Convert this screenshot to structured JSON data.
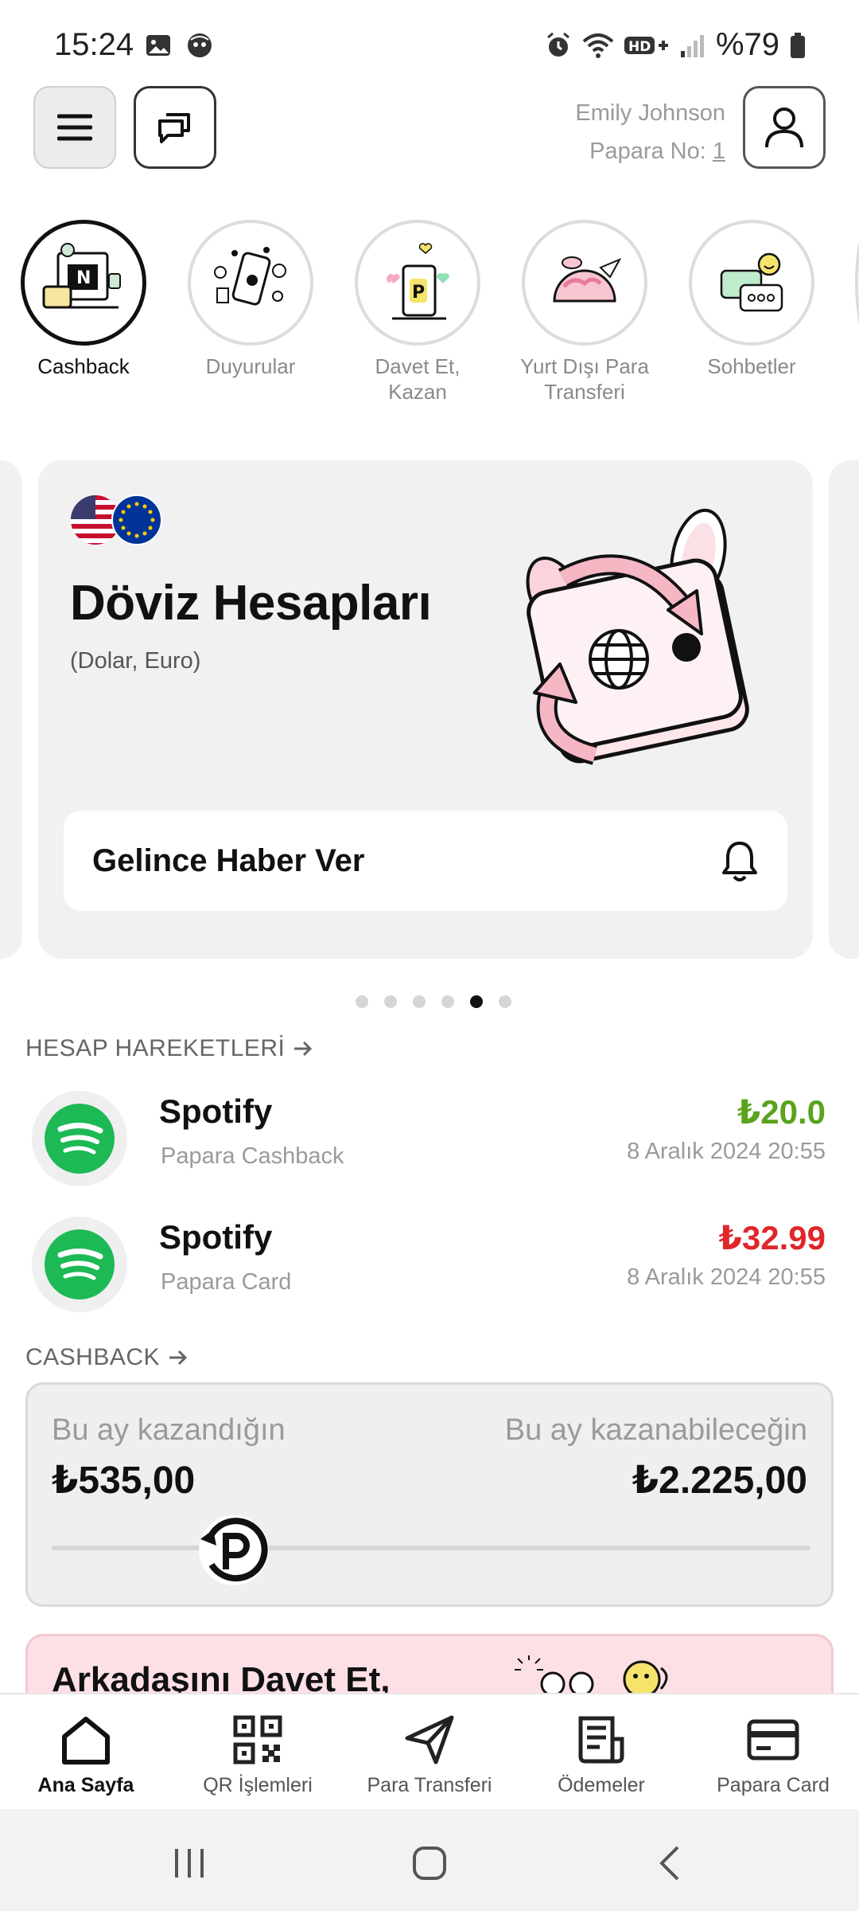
{
  "status_bar": {
    "time": "15:24",
    "battery": "%79",
    "icons": [
      "image-icon",
      "face-icon",
      "alarm-icon",
      "wifi-icon",
      "hd-plus-icon",
      "signal-icon",
      "battery-icon"
    ]
  },
  "header": {
    "user_name": "Emily Johnson",
    "papara_no_label": "Papara No:",
    "papara_no_value": "1"
  },
  "stories": [
    {
      "label": "Cashback",
      "active": true
    },
    {
      "label": "Duyurular",
      "active": false
    },
    {
      "label": "Davet Et, Kazan",
      "active": false
    },
    {
      "label": "Yurt Dışı Para Transferi",
      "active": false
    },
    {
      "label": "Sohbetler",
      "active": false
    }
  ],
  "promo": {
    "title": "Döviz Hesapları",
    "subtitle": "(Dolar, Euro)",
    "button_label": "Gelince Haber Ver",
    "dots_count": 6,
    "active_dot": 5
  },
  "transactions": {
    "heading": "HESAP HAREKETLERİ",
    "items": [
      {
        "name": "Spotify",
        "sub": "Papara Cashback",
        "amount": "₺20.0",
        "date": "8 Aralık 2024 20:55",
        "color": "#5aa31c"
      },
      {
        "name": "Spotify",
        "sub": "Papara Card",
        "amount": "₺32.99",
        "date": "8 Aralık 2024 20:55",
        "color": "#e0262b"
      }
    ]
  },
  "cashback": {
    "heading": "CASHBACK",
    "earned_label": "Bu ay kazandığın",
    "earned_value": "₺535,00",
    "potential_label": "Bu ay kazanabileceğin",
    "potential_value": "₺2.225,00",
    "progress_fraction": 0.24
  },
  "invite": {
    "title": "Arkadaşını Davet Et,"
  },
  "bottom_nav": [
    {
      "label": "Ana Sayfa",
      "icon": "home-icon",
      "active": true
    },
    {
      "label": "QR İşlemleri",
      "icon": "qr-icon",
      "active": false
    },
    {
      "label": "Para Transferi",
      "icon": "send-icon",
      "active": false
    },
    {
      "label": "Ödemeler",
      "icon": "bill-icon",
      "active": false
    },
    {
      "label": "Papara Card",
      "icon": "card-icon",
      "active": false
    }
  ],
  "colors": {
    "positive": "#5aa31c",
    "negative": "#e0262b",
    "spotify": "#1db954",
    "invite_bg": "#fde0e5"
  }
}
